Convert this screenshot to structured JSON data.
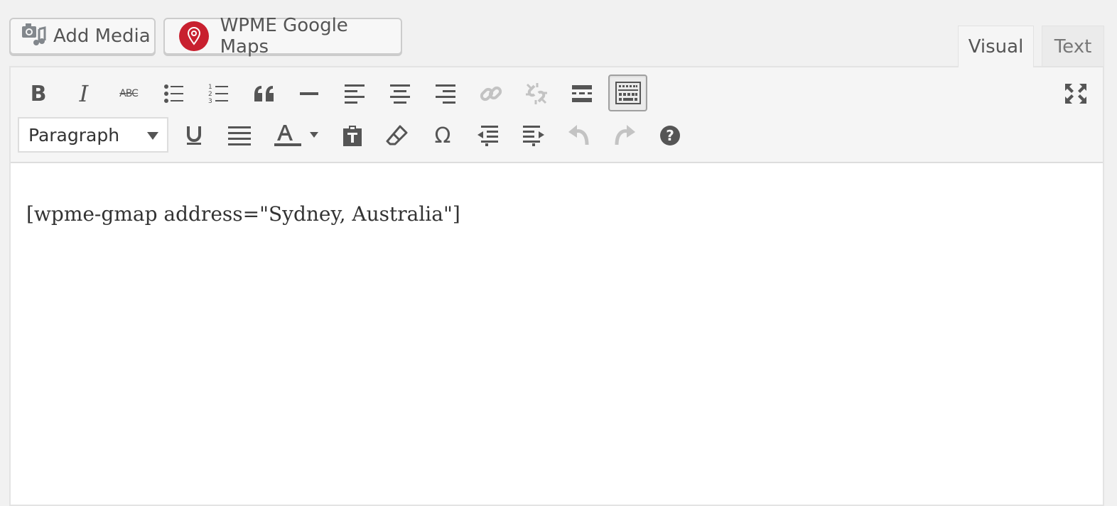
{
  "media_buttons": {
    "add_media": "Add Media",
    "wpme_maps": "WPME Google Maps"
  },
  "tabs": {
    "visual": "Visual",
    "text": "Text",
    "active": "visual"
  },
  "toolbar": {
    "format_select": "Paragraph",
    "row1": [
      "bold",
      "italic",
      "strikethrough",
      "bulleted-list",
      "numbered-list",
      "blockquote",
      "horizontal-line",
      "align-left",
      "align-center",
      "align-right",
      "insert-link",
      "remove-link",
      "read-more",
      "toolbar-toggle",
      "fullscreen"
    ],
    "row2": [
      "underline",
      "justify",
      "text-color",
      "paste-as-text",
      "clear-formatting",
      "special-character",
      "outdent",
      "indent",
      "undo",
      "redo",
      "help"
    ],
    "strike_label": "ABC",
    "omega": "Ω"
  },
  "editor": {
    "content": "[wpme-gmap address=\"Sydney, Australia\"]"
  },
  "colors": {
    "brand_pin": "#c8202f",
    "icon": "#555555",
    "icon_disabled": "#c3c3c3"
  }
}
